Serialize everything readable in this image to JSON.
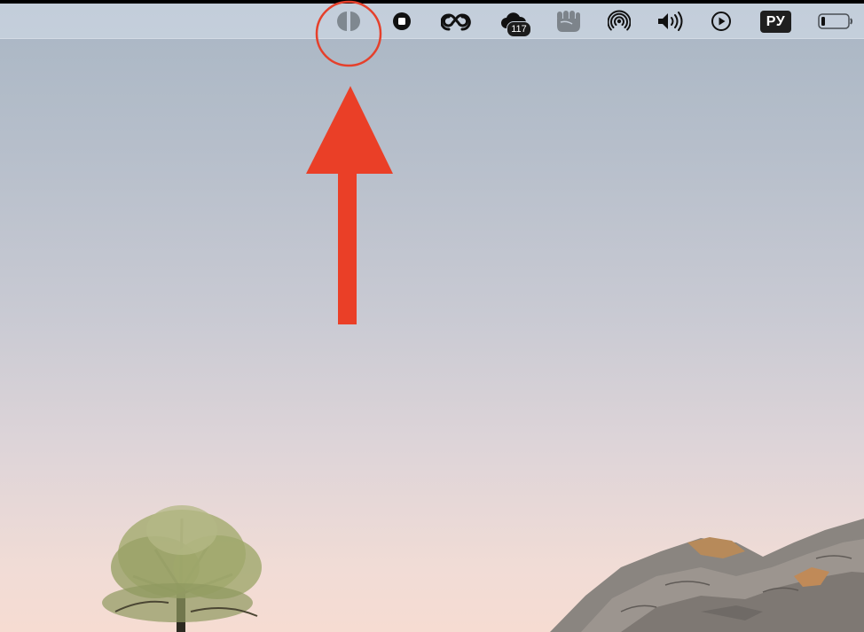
{
  "menubar": {
    "items": [
      {
        "icon": "contrast-icon"
      },
      {
        "icon": "stop-icon"
      },
      {
        "icon": "creative-cloud-icon"
      },
      {
        "icon": "cloud-badge-icon",
        "badge": "117"
      },
      {
        "icon": "fist-icon"
      },
      {
        "icon": "airdrop-icon"
      },
      {
        "icon": "volume-icon"
      },
      {
        "icon": "play-icon"
      },
      {
        "icon": "input-language",
        "label": "РУ"
      },
      {
        "icon": "battery-icon"
      }
    ]
  },
  "annotation": {
    "highlight_color": "#e5402b",
    "arrow_color": "#ea3f27"
  }
}
